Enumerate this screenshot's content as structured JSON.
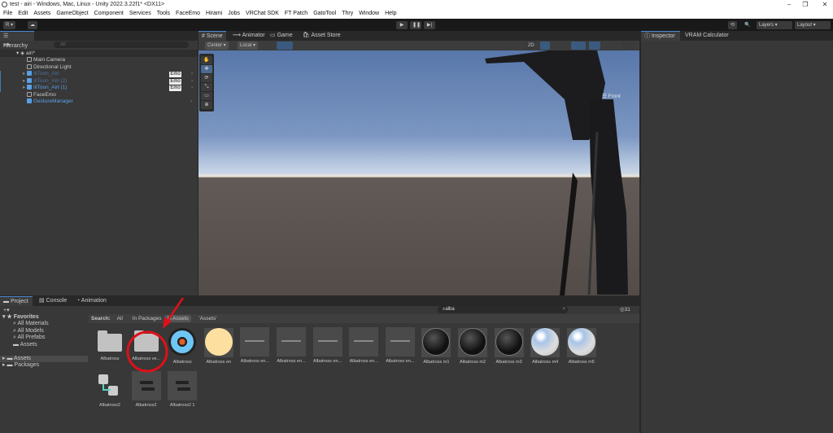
{
  "window": {
    "title": "test - airi - Windows, Mac, Linux - Unity 2022.3.22f1* <DX11>",
    "minimize": "–",
    "maximize": "❐",
    "close": "✕"
  },
  "menu": [
    "File",
    "Edit",
    "Assets",
    "GameObject",
    "Component",
    "Services",
    "Tools",
    "FaceEmo",
    "Hirami",
    "Jobs",
    "VRChat SDK",
    "FT Patch",
    "GatoTool",
    "Thry",
    "Window",
    "Help"
  ],
  "toolbar": {
    "account": "R ▾",
    "cloud": "☁",
    "play": "▶",
    "pause": "❚❚",
    "step": "▶|",
    "history": "⟲",
    "search": "🔍",
    "layers": "Layers",
    "layout": "Layout"
  },
  "hierarchy": {
    "tab": "Hierarchy",
    "add": "+▾",
    "search_placeholder": "All",
    "scene": "airi*",
    "items": [
      {
        "label": "Main Camera",
        "cls": ""
      },
      {
        "label": "Directional Light",
        "cls": ""
      },
      {
        "label": "lilToon_Airi",
        "cls": "dim",
        "badge": "Emo"
      },
      {
        "label": "lilToon_Airi (2)",
        "cls": "dim",
        "badge": "Emo"
      },
      {
        "label": "lilToon_Airi (1)",
        "cls": "blue",
        "badge": "Emo"
      },
      {
        "label": "FaceEmo",
        "cls": ""
      },
      {
        "label": "GestureManager",
        "cls": "blue"
      }
    ]
  },
  "scene": {
    "tabs": [
      "Scene",
      "Animator",
      "Game",
      "Asset Store"
    ],
    "pivot": "Center ▾",
    "space": "Local ▾",
    "mode_2d": "2D",
    "view_label": "Front",
    "tools": [
      "✋",
      "✥",
      "⟳",
      "⤡",
      "▭",
      "⊕"
    ]
  },
  "inspector": {
    "tabs": [
      "Inspector",
      "VRAM Calculator"
    ]
  },
  "project": {
    "tabs": [
      "Project",
      "Console",
      "Animation"
    ],
    "add": "+▾",
    "search_value": "alba",
    "hidden_count": "31",
    "sidebar": {
      "favorites": "Favorites",
      "fav_items": [
        "All Materials",
        "All Models",
        "All Prefabs",
        "Assets"
      ],
      "roots": [
        "Assets",
        "Packages"
      ]
    },
    "search_label": "Search:",
    "scopes": [
      "All",
      "In Packages",
      "In Assets",
      "'Assets'"
    ],
    "assets": [
      {
        "label": "Albatross",
        "kind": "folder"
      },
      {
        "label": "Albatross ve...",
        "kind": "folder"
      },
      {
        "label": "Albatross",
        "kind": "avatar"
      },
      {
        "label": "Albatross en",
        "kind": "circle"
      },
      {
        "label": "Albatross en...",
        "kind": "anim"
      },
      {
        "label": "Albatross en...",
        "kind": "anim"
      },
      {
        "label": "Albatross en...",
        "kind": "anim"
      },
      {
        "label": "Albatross en...",
        "kind": "anim"
      },
      {
        "label": "Albatross en...",
        "kind": "anim"
      },
      {
        "label": "Albatross m1",
        "kind": "dark"
      },
      {
        "label": "Albatross m2",
        "kind": "dark2"
      },
      {
        "label": "Albatross m3",
        "kind": "dark3"
      },
      {
        "label": "Albatross m4",
        "kind": "shiny"
      },
      {
        "label": "Albatross m5",
        "kind": "shiny"
      },
      {
        "label": "Albatross2",
        "kind": "controller"
      },
      {
        "label": "Albatross2",
        "kind": "model"
      },
      {
        "label": "Albatross2 1",
        "kind": "model"
      }
    ]
  },
  "colors": {
    "accent": "#4a8ad0",
    "annotation": "#e0101a"
  }
}
